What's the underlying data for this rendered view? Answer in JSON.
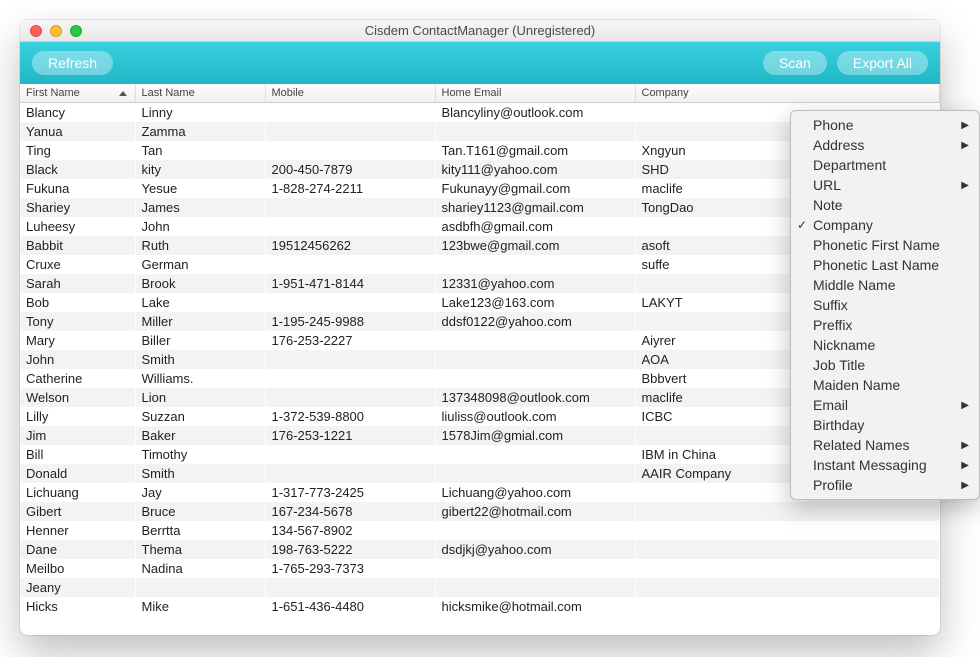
{
  "window": {
    "title": "Cisdem ContactManager (Unregistered)"
  },
  "toolbar": {
    "refresh": "Refresh",
    "scan": "Scan",
    "exportAll": "Export All"
  },
  "columns": {
    "firstName": "First Name",
    "lastName": "Last Name",
    "mobile": "Mobile",
    "homeEmail": "Home Email",
    "company": "Company"
  },
  "rows": [
    {
      "first": "Blancy",
      "last": "Linny",
      "mobile": "",
      "email": "Blancyliny@outlook.com",
      "company": ""
    },
    {
      "first": "Yanua",
      "last": "Zamma",
      "mobile": "",
      "email": "",
      "company": ""
    },
    {
      "first": "Ting",
      "last": "Tan",
      "mobile": "",
      "email": "Tan.T161@gmail.com",
      "company": "Xngyun"
    },
    {
      "first": "Black",
      "last": "kity",
      "mobile": "200-450-7879",
      "email": "kity111@yahoo.com",
      "company": "SHD"
    },
    {
      "first": "Fukuna",
      "last": "Yesue",
      "mobile": "1-828-274-2211",
      "email": "Fukunayy@gmail.com",
      "company": "maclife"
    },
    {
      "first": "Shariey",
      "last": "James",
      "mobile": "",
      "email": "shariey1123@gmail.com",
      "company": "TongDao"
    },
    {
      "first": "Luheesy",
      "last": "John",
      "mobile": "",
      "email": "asdbfh@gmail.com",
      "company": ""
    },
    {
      "first": "Babbit",
      "last": "Ruth",
      "mobile": "19512456262",
      "email": "123bwe@gmail.com",
      "company": "asoft"
    },
    {
      "first": "Cruxe",
      "last": "German",
      "mobile": "",
      "email": "",
      "company": "suffe"
    },
    {
      "first": "Sarah",
      "last": "Brook",
      "mobile": "1-951-471-8144",
      "email": "12331@yahoo.com",
      "company": ""
    },
    {
      "first": "Bob",
      "last": "Lake",
      "mobile": "",
      "email": "Lake123@163.com",
      "company": "LAKYT"
    },
    {
      "first": "Tony",
      "last": "Miller",
      "mobile": "1-195-245-9988",
      "email": "ddsf0122@yahoo.com",
      "company": ""
    },
    {
      "first": "Mary",
      "last": "Biller",
      "mobile": "176-253-2227",
      "email": "",
      "company": "Aiyrer"
    },
    {
      "first": "John",
      "last": "Smith",
      "mobile": "",
      "email": "",
      "company": "AOA"
    },
    {
      "first": "Catherine",
      "last": "Williams.",
      "mobile": "",
      "email": "",
      "company": "Bbbvert"
    },
    {
      "first": "Welson",
      "last": "Lion",
      "mobile": "",
      "email": "137348098@outlook.com",
      "company": "maclife"
    },
    {
      "first": "Lilly",
      "last": "Suzzan",
      "mobile": "1-372-539-8800",
      "email": "liuliss@outlook.com",
      "company": "ICBC"
    },
    {
      "first": "Jim",
      "last": "Baker",
      "mobile": "176-253-1221",
      "email": "1578Jim@gmial.com",
      "company": ""
    },
    {
      "first": "Bill",
      "last": "Timothy",
      "mobile": "",
      "email": "",
      "company": "IBM in China"
    },
    {
      "first": "Donald",
      "last": "Smith",
      "mobile": "",
      "email": "",
      "company": "AAIR Company"
    },
    {
      "first": "Lichuang",
      "last": "Jay",
      "mobile": "1-317-773-2425",
      "email": "Lichuang@yahoo.com",
      "company": ""
    },
    {
      "first": "Gibert",
      "last": "Bruce",
      "mobile": "167-234-5678",
      "email": "gibert22@hotmail.com",
      "company": ""
    },
    {
      "first": "Henner",
      "last": "Berrtta",
      "mobile": "134-567-8902",
      "email": "",
      "company": ""
    },
    {
      "first": "Dane",
      "last": "Thema",
      "mobile": "198-763-5222",
      "email": "dsdjkj@yahoo.com",
      "company": ""
    },
    {
      "first": "Meilbo",
      "last": "Nadina",
      "mobile": "1-765-293-7373",
      "email": "",
      "company": ""
    },
    {
      "first": "Jeany",
      "last": "",
      "mobile": "",
      "email": "",
      "company": ""
    },
    {
      "first": "Hicks",
      "last": "Mike",
      "mobile": "1-651-436-4480",
      "email": "hicksmike@hotmail.com",
      "company": ""
    }
  ],
  "menu": [
    {
      "label": "Phone",
      "sub": true,
      "checked": false
    },
    {
      "label": "Address",
      "sub": true,
      "checked": false
    },
    {
      "label": "Department",
      "sub": false,
      "checked": false
    },
    {
      "label": "URL",
      "sub": true,
      "checked": false
    },
    {
      "label": "Note",
      "sub": false,
      "checked": false
    },
    {
      "label": "Company",
      "sub": false,
      "checked": true
    },
    {
      "label": "Phonetic First Name",
      "sub": false,
      "checked": false
    },
    {
      "label": "Phonetic Last Name",
      "sub": false,
      "checked": false
    },
    {
      "label": "Middle Name",
      "sub": false,
      "checked": false
    },
    {
      "label": "Suffix",
      "sub": false,
      "checked": false
    },
    {
      "label": "Preffix",
      "sub": false,
      "checked": false
    },
    {
      "label": "Nickname",
      "sub": false,
      "checked": false
    },
    {
      "label": "Job Title",
      "sub": false,
      "checked": false
    },
    {
      "label": "Maiden Name",
      "sub": false,
      "checked": false
    },
    {
      "label": "Email",
      "sub": true,
      "checked": false
    },
    {
      "label": "Birthday",
      "sub": false,
      "checked": false
    },
    {
      "label": "Related Names",
      "sub": true,
      "checked": false
    },
    {
      "label": "Instant Messaging",
      "sub": true,
      "checked": false
    },
    {
      "label": "Profile",
      "sub": true,
      "checked": false
    }
  ]
}
